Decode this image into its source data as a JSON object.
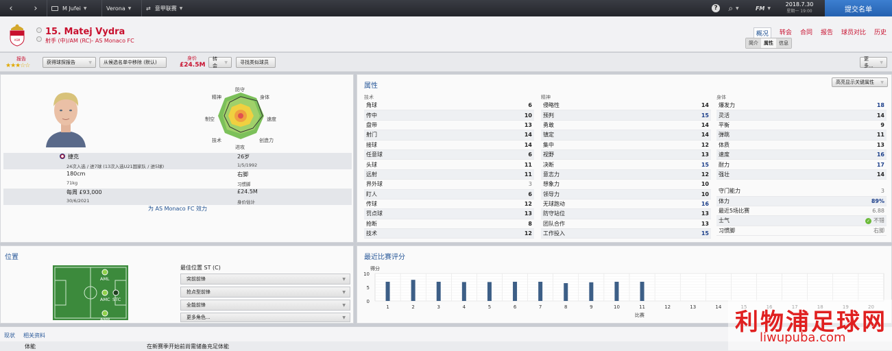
{
  "topbar": {
    "back": "‹",
    "forward": "›",
    "manager": "M Jufei",
    "club": "Verona",
    "league": "意甲联赛",
    "help": "?",
    "search": "⌕",
    "fm": "FM",
    "date": "2018.7.30",
    "day": "星期一 19:00",
    "submit": "提交名单"
  },
  "player": {
    "name": "15. Matej Vydra",
    "role": "射手 (中)/AM (RC)- AS Monaco FC"
  },
  "nav": {
    "items": [
      "概况",
      "转会",
      "合同",
      "报告",
      "球员对比",
      "历史"
    ],
    "active": 0,
    "subtabs": [
      "简介",
      "属性",
      "信息"
    ],
    "subactive": 1
  },
  "actionbar": {
    "report_label": "报告",
    "stars": "★★★☆☆",
    "get_report": "获得球探报告",
    "remove_shortlist": "从候选名单中移除 (默认)",
    "value_label": "身价",
    "value": "£24.5M",
    "transfer": "转会",
    "find_similar": "寻找类似球员",
    "more": "更多..."
  },
  "profile": {
    "nation": "捷克",
    "caps": "24次入选 / 进7球 (13次入选U21国家队 / 进5球)",
    "age": "26岁",
    "dob": "1/5/1992",
    "height": "180cm",
    "foot": "右脚",
    "weight": "71kg",
    "foot_label": "习惯脚",
    "wage": "每周 £93,000",
    "value": "£24.5M",
    "contract": "30/6/2021",
    "value_label": "身价估计",
    "club_line": "为 AS Monaco FC 效力"
  },
  "radar": {
    "labels": [
      "防守",
      "身体",
      "速度",
      "创造力",
      "进攻",
      "技术",
      "制空",
      "精神"
    ]
  },
  "attributes": {
    "title": "属性",
    "highlight_btn": "高亮显示关键属性",
    "technical": {
      "header": "技术",
      "rows": [
        [
          "角球",
          "6"
        ],
        [
          "传中",
          "10"
        ],
        [
          "盘带",
          "13"
        ],
        [
          "射门",
          "14"
        ],
        [
          "接球",
          "14"
        ],
        [
          "任意球",
          "6"
        ],
        [
          "头球",
          "11"
        ],
        [
          "远射",
          "11"
        ],
        [
          "界外球",
          "3"
        ],
        [
          "盯人",
          "6"
        ],
        [
          "传球",
          "12"
        ],
        [
          "罚点球",
          "13"
        ],
        [
          "抢断",
          "8"
        ],
        [
          "技术",
          "12"
        ]
      ]
    },
    "mental": {
      "header": "精神",
      "rows": [
        [
          "侵略性",
          "14"
        ],
        [
          "预判",
          "15"
        ],
        [
          "勇敢",
          "14"
        ],
        [
          "镇定",
          "14"
        ],
        [
          "集中",
          "12"
        ],
        [
          "视野",
          "13"
        ],
        [
          "决断",
          "15"
        ],
        [
          "意志力",
          "12"
        ],
        [
          "想象力",
          "10"
        ],
        [
          "领导力",
          "10"
        ],
        [
          "无球跑动",
          "16"
        ],
        [
          "防守站位",
          "13"
        ],
        [
          "团队合作",
          "13"
        ],
        [
          "工作投入",
          "15"
        ]
      ]
    },
    "physical": {
      "header": "身体",
      "rows": [
        [
          "爆发力",
          "18"
        ],
        [
          "灵活",
          "14"
        ],
        [
          "平衡",
          "9"
        ],
        [
          "弹跳",
          "11"
        ],
        [
          "体质",
          "13"
        ],
        [
          "速度",
          "16"
        ],
        [
          "耐力",
          "17"
        ],
        [
          "强壮",
          "14"
        ]
      ]
    },
    "extra": [
      [
        "守门能力",
        "3"
      ],
      [
        "体力",
        "89%"
      ],
      [
        "最近5场比赛",
        "6.88"
      ],
      [
        "士气",
        "不错"
      ],
      [
        "习惯脚",
        "右脚"
      ]
    ]
  },
  "position": {
    "title": "位置",
    "best_label": "最佳位置 ST (C)",
    "roles": [
      "突前前锋",
      "抢点型前锋",
      "全能前锋",
      "更多角色..."
    ],
    "pitch_labels": [
      "AML",
      "AMC",
      "STC",
      "AMR"
    ]
  },
  "ratings": {
    "title": "最近比赛评分",
    "ylabel": "得分",
    "xlabel": "比赛"
  },
  "chart_data": {
    "type": "bar",
    "title": "最近比赛评分",
    "ylabel": "得分",
    "xlabel": "比赛",
    "ylim": [
      0,
      10
    ],
    "yticks": [
      0,
      5,
      10
    ],
    "categories": [
      "1",
      "2",
      "3",
      "4",
      "5",
      "6",
      "7",
      "8",
      "9",
      "10",
      "11",
      "12",
      "13",
      "14",
      "15",
      "16",
      "17",
      "18",
      "19",
      "20"
    ],
    "values": [
      7.0,
      7.7,
      7.0,
      6.9,
      6.9,
      7.0,
      7.0,
      6.5,
      6.8,
      7.0,
      7.0,
      null,
      null,
      null,
      null,
      null,
      null,
      null,
      null,
      null
    ],
    "colors": {
      "bar": "#3d5f87"
    }
  },
  "footer": {
    "tabs": [
      "现状",
      "相关资料"
    ],
    "row_label": "体能",
    "row_value": "在新赛季开始前尚需储备充足体能"
  },
  "watermark": {
    "cn": "利物浦足球网",
    "en": "liwupuba.com"
  }
}
